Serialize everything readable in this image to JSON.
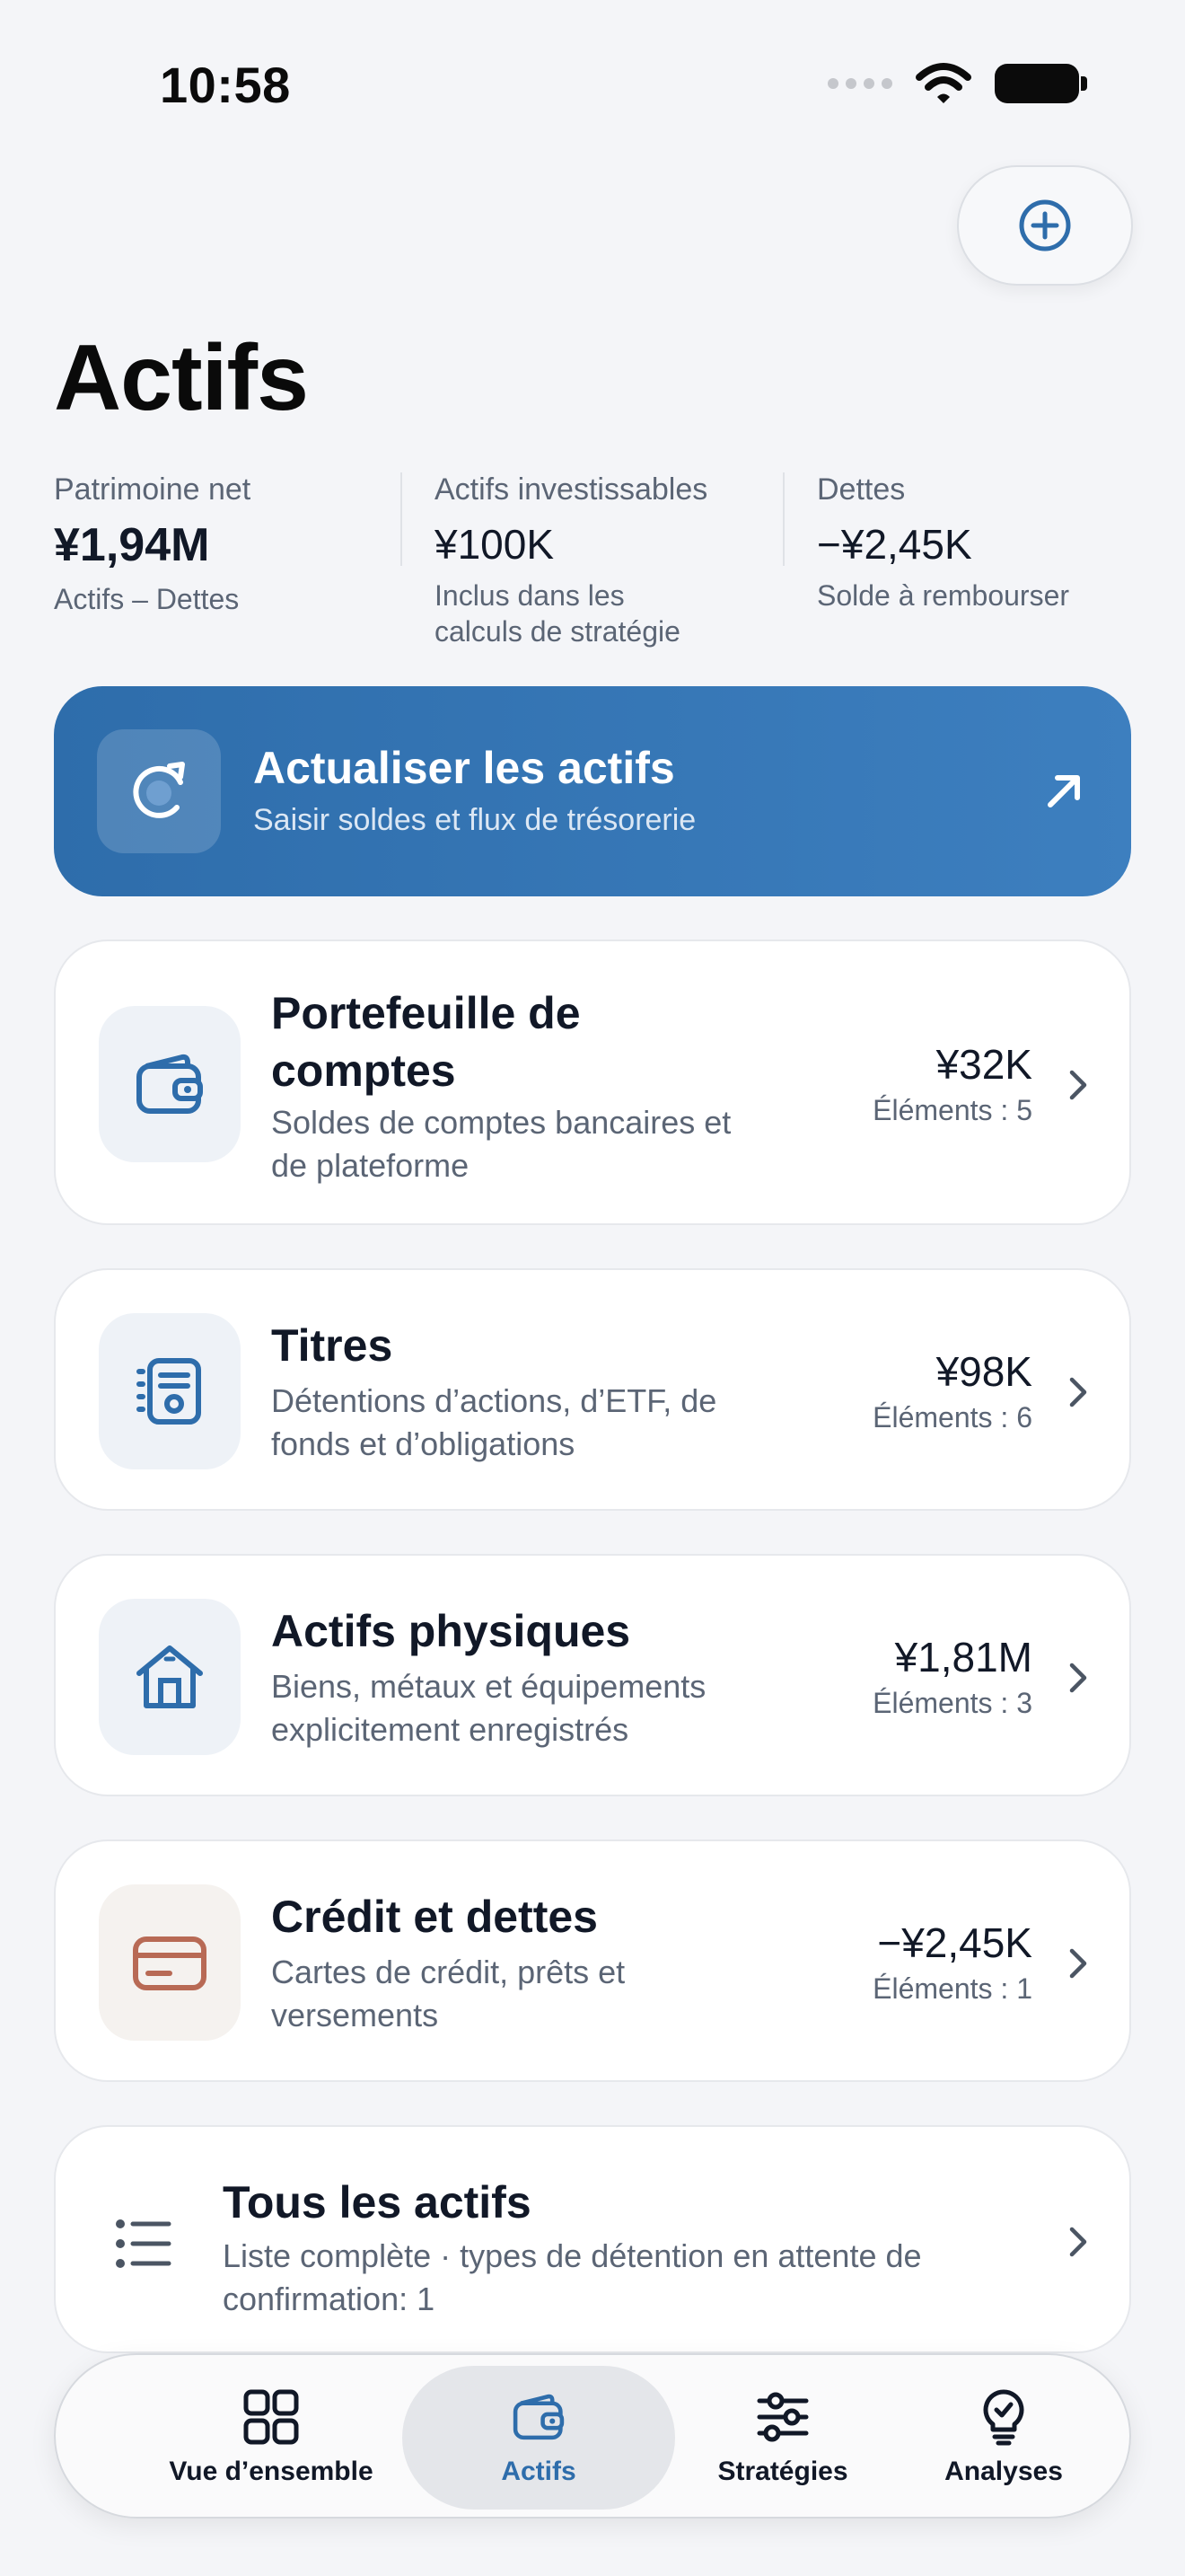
{
  "status_bar": {
    "time": "10:58"
  },
  "header": {
    "title": "Actifs"
  },
  "summary": {
    "net_worth": {
      "label": "Patrimoine net",
      "value": "¥1,94M",
      "sub": "Actifs – Dettes"
    },
    "investable": {
      "label": "Actifs investissables",
      "value": "¥100K",
      "sub_line1": "Inclus dans les",
      "sub_line2": "calculs de stratégie"
    },
    "debts": {
      "label": "Dettes",
      "value": "−¥2,45K",
      "sub": "Solde à rembourser"
    }
  },
  "refresh": {
    "title": "Actualiser les actifs",
    "subtitle": "Saisir soldes et flux de trésorerie"
  },
  "categories": [
    {
      "title_line1": "Portefeuille de",
      "title_line2": "comptes",
      "desc_line1": "Soldes de comptes bancaires et",
      "desc_line2": "de plateforme",
      "value": "¥32K",
      "count": "Éléments : 5",
      "icon": "wallet-icon"
    },
    {
      "title_line1": "Titres",
      "desc_line1": "Détentions d’actions, d’ETF, de",
      "desc_line2": "fonds et d’obligations",
      "value": "¥98K",
      "count": "Éléments : 6",
      "icon": "securities-icon"
    },
    {
      "title_line1": "Actifs physiques",
      "desc_line1": "Biens, métaux et équipements",
      "desc_line2": "explicitement enregistrés",
      "value": "¥1,81M",
      "count": "Éléments : 3",
      "icon": "house-icon"
    },
    {
      "title_line1": "Crédit et dettes",
      "desc_line1": "Cartes de crédit, prêts et",
      "desc_line2": "versements",
      "value": "−¥2,45K",
      "count": "Éléments : 1",
      "icon": "credit-card-icon"
    }
  ],
  "all_assets": {
    "title": "Tous les actifs",
    "desc_line1": "Liste complète · types de détention en attente de",
    "desc_line2": "confirmation: 1"
  },
  "tabs": [
    {
      "label": "Vue d’ensemble",
      "icon": "grid-icon"
    },
    {
      "label": "Actifs",
      "icon": "wallet-icon",
      "active": true
    },
    {
      "label": "Stratégies",
      "icon": "sliders-icon"
    },
    {
      "label": "Analyses",
      "icon": "lightbulb-icon"
    }
  ],
  "colors": {
    "accent": "#2e6dab",
    "debt_icon": "#b86a55"
  }
}
